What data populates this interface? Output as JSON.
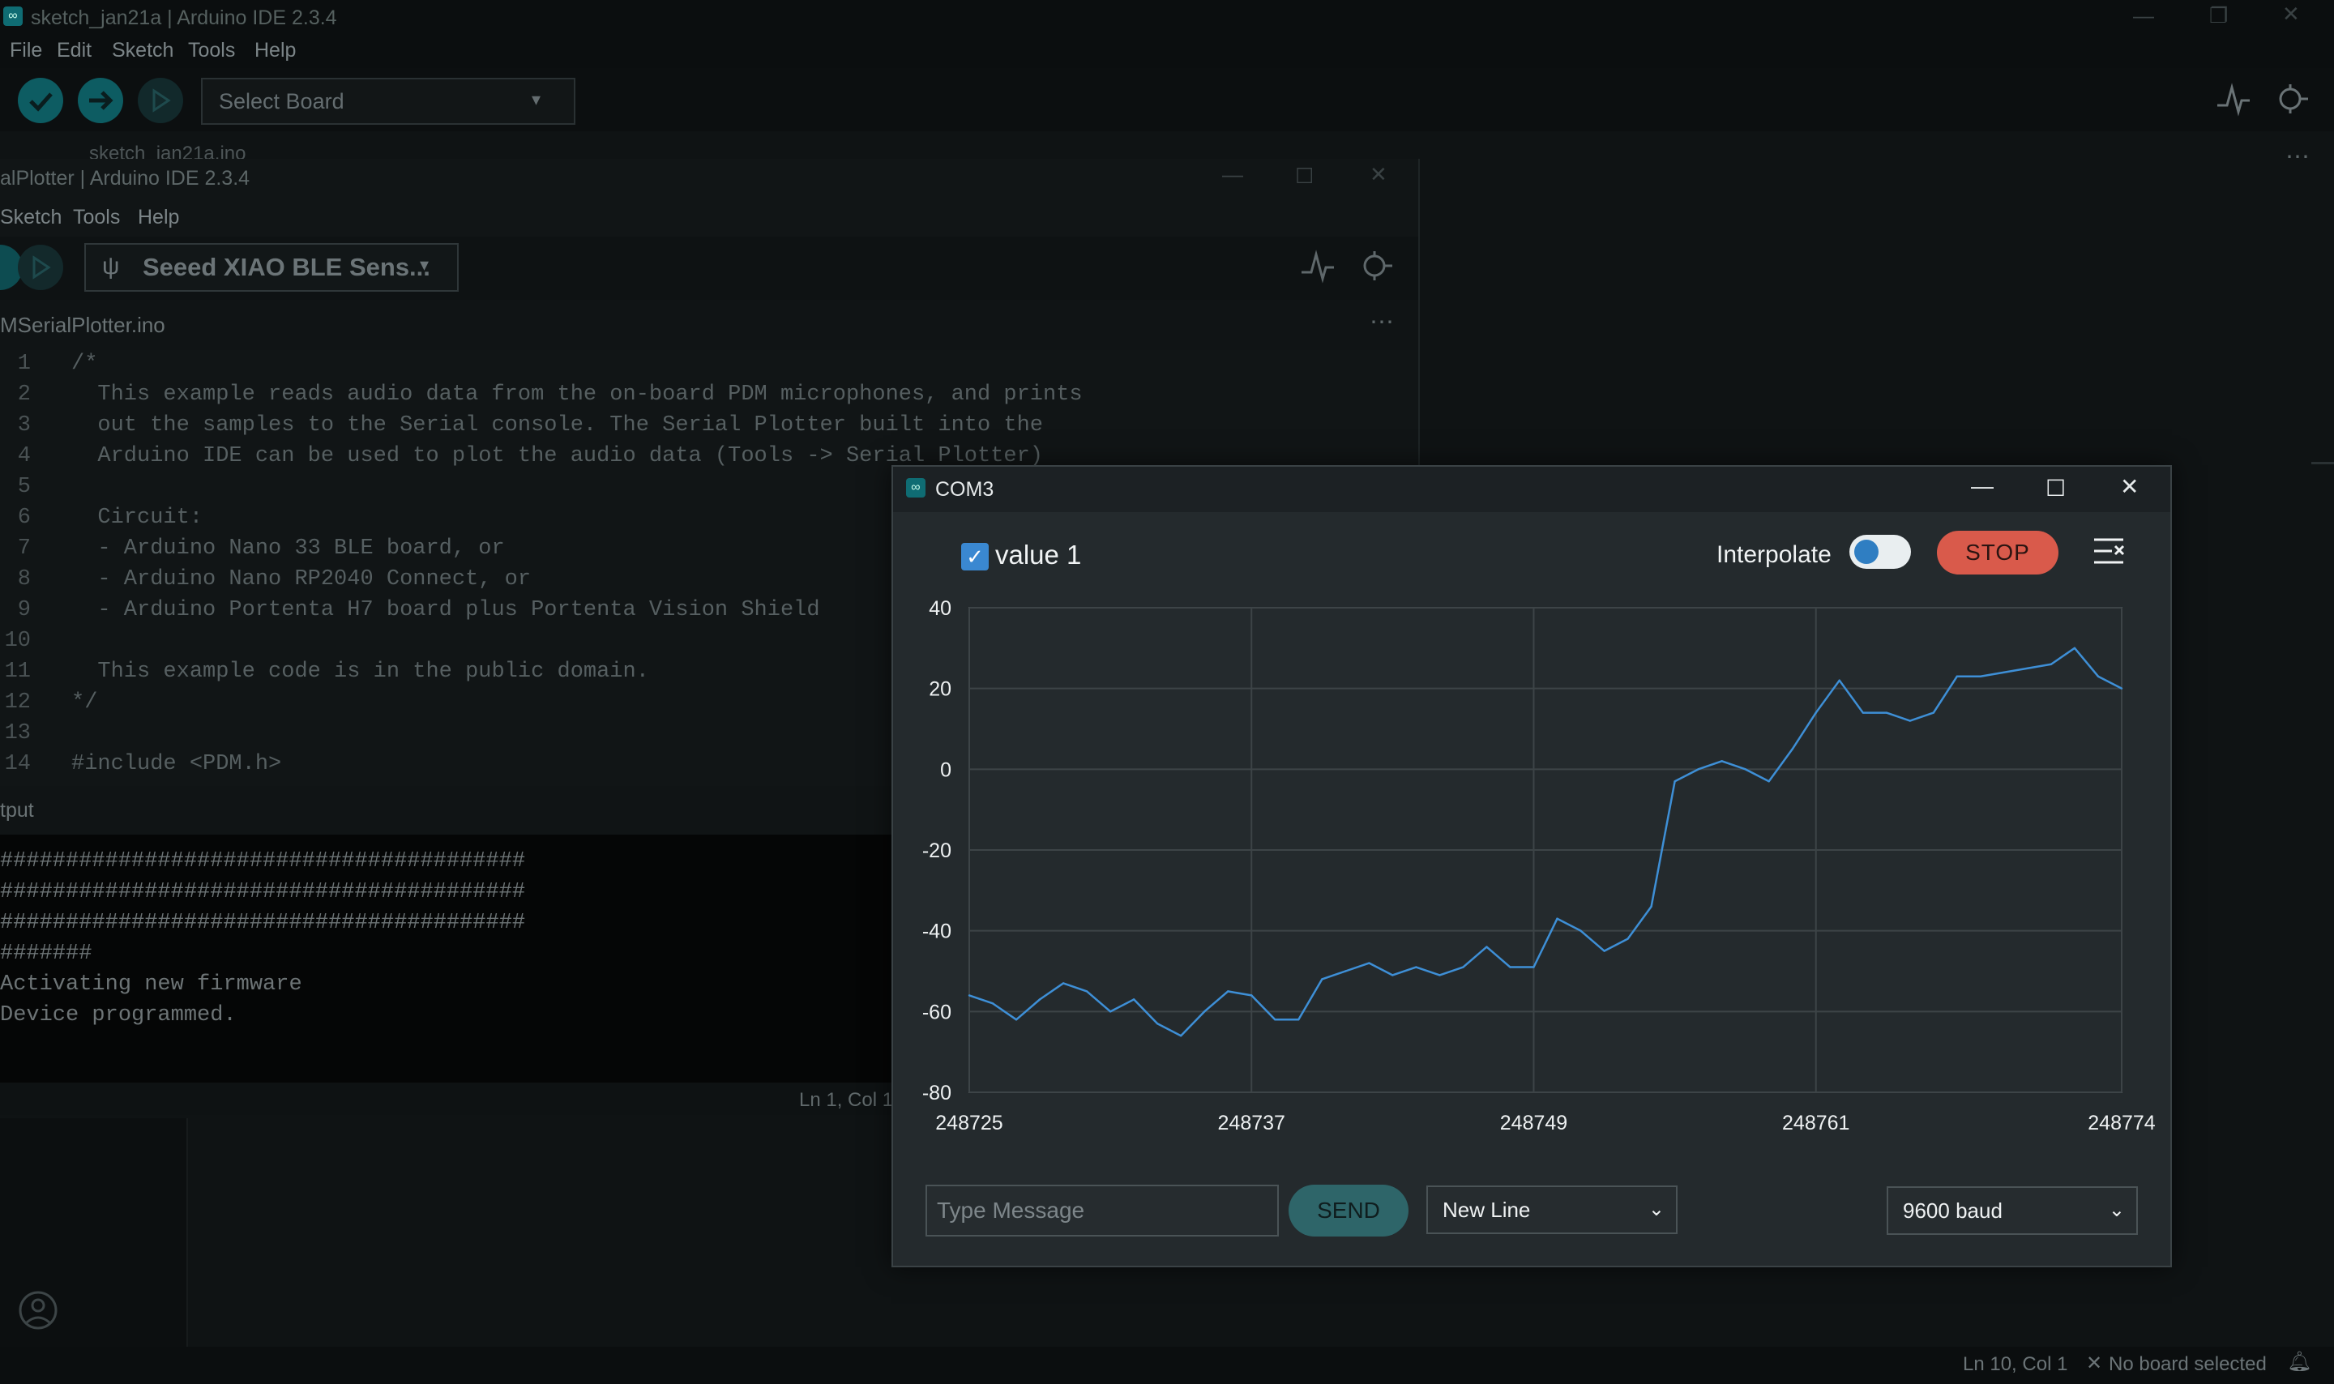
{
  "main_window": {
    "title": "sketch_jan21a | Arduino IDE 2.3.4",
    "menu": [
      "File",
      "Edit",
      "Sketch",
      "Tools",
      "Help"
    ],
    "board_select": "Select Board",
    "partial_tab": "sketch_jan21a.ino",
    "status": {
      "position": "Ln 10, Col 1",
      "board": "No board selected"
    }
  },
  "sketch_window": {
    "title": "alPlotter | Arduino IDE 2.3.4",
    "menu": [
      "Sketch",
      "Tools",
      "Help"
    ],
    "board": "Seeed XIAO BLE Sens...",
    "tab": "MSerialPlotter.ino",
    "code_lines": [
      {
        "n": "1",
        "t": "/*"
      },
      {
        "n": "2",
        "t": "  This example reads audio data from the on-board PDM microphones, and prints"
      },
      {
        "n": "3",
        "t": "  out the samples to the Serial console. The Serial Plotter built into the"
      },
      {
        "n": "4",
        "t": "  Arduino IDE can be used to plot the audio data (Tools -> Serial Plotter)"
      },
      {
        "n": "5",
        "t": ""
      },
      {
        "n": "6",
        "t": "  Circuit:"
      },
      {
        "n": "7",
        "t": "  - Arduino Nano 33 BLE board, or"
      },
      {
        "n": "8",
        "t": "  - Arduino Nano RP2040 Connect, or"
      },
      {
        "n": "9",
        "t": "  - Arduino Portenta H7 board plus Portenta Vision Shield"
      },
      {
        "n": "10",
        "t": ""
      },
      {
        "n": "11",
        "t": "  This example code is in the public domain."
      },
      {
        "n": "12",
        "t": "*/"
      },
      {
        "n": "13",
        "t": ""
      },
      {
        "n": "14",
        "t": "#include <PDM.h>"
      }
    ],
    "output_title": "tput",
    "output_lines": [
      "########################################",
      "########################################",
      "########################################",
      "#######",
      "Activating new firmware",
      "Device programmed."
    ],
    "status_position": "Ln 1, Col 1"
  },
  "plotter": {
    "title": "COM3",
    "series_checkbox_label": "value 1",
    "interpolate_label": "Interpolate",
    "stop_label": "STOP",
    "message_placeholder": "Type Message",
    "send_label": "SEND",
    "line_ending": "New Line",
    "baud": "9600 baud"
  },
  "chart_data": {
    "type": "line",
    "x_ticks": [
      248725,
      248737,
      248749,
      248761,
      248774
    ],
    "xlim": [
      248725,
      248774
    ],
    "y_ticks": [
      40,
      20,
      0,
      -20,
      -40,
      -60,
      -80
    ],
    "ylim": [
      -80,
      40
    ],
    "grid": true,
    "series": [
      {
        "name": "value 1",
        "color": "#3e8fd6",
        "x": [
          248725,
          248726,
          248727,
          248728,
          248729,
          248730,
          248731,
          248732,
          248733,
          248734,
          248735,
          248736,
          248737,
          248738,
          248739,
          248740,
          248741,
          248742,
          248743,
          248744,
          248745,
          248746,
          248747,
          248748,
          248749,
          248750,
          248751,
          248752,
          248753,
          248754,
          248755,
          248756,
          248757,
          248758,
          248759,
          248760,
          248761,
          248762,
          248763,
          248764,
          248765,
          248766,
          248767,
          248768,
          248769,
          248770,
          248771,
          248772,
          248773,
          248774
        ],
        "values": [
          -56,
          -58,
          -62,
          -57,
          -53,
          -55,
          -60,
          -57,
          -63,
          -66,
          -60,
          -55,
          -56,
          -62,
          -62,
          -52,
          -50,
          -48,
          -51,
          -49,
          -51,
          -49,
          -44,
          -49,
          -49,
          -37,
          -40,
          -45,
          -42,
          -34,
          -3,
          0,
          2,
          0,
          -3,
          5,
          14,
          22,
          14,
          14,
          12,
          14,
          23,
          23,
          24,
          25,
          26,
          30,
          23,
          20
        ]
      }
    ]
  }
}
